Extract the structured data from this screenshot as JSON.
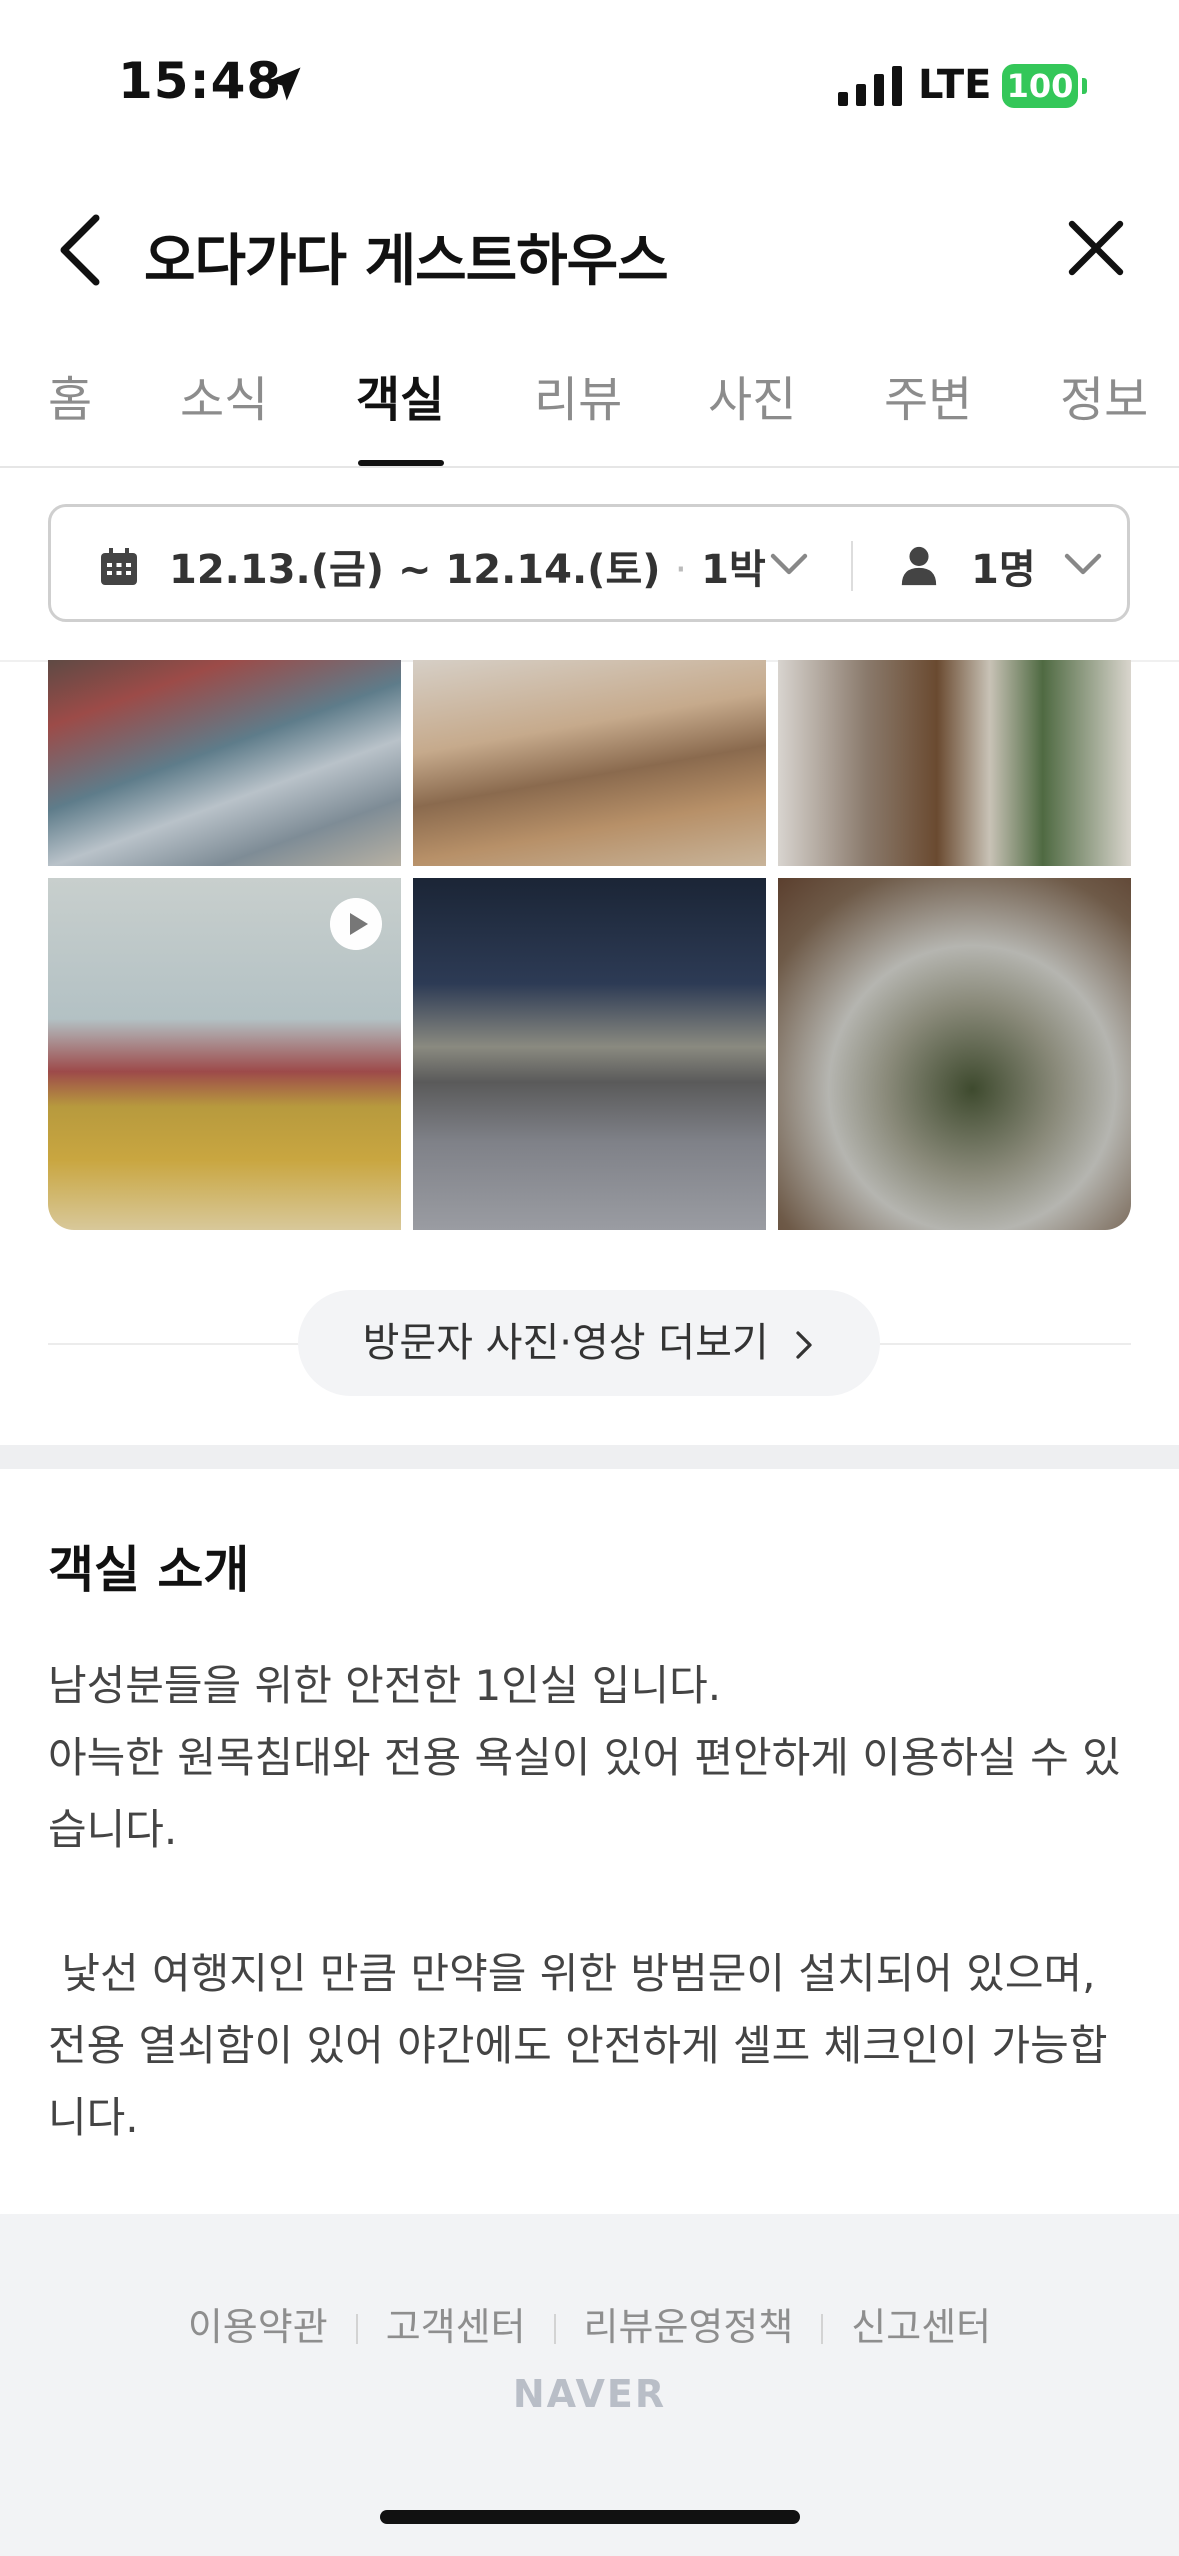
{
  "status_bar": {
    "time": "15:48",
    "network": "LTE",
    "battery": "100",
    "battery_color": "#34c759"
  },
  "header": {
    "title": "오다가다 게스트하우스",
    "back_icon": "chevron-left-icon",
    "close_icon": "close-icon"
  },
  "tabs": [
    {
      "label": "홈",
      "active": false
    },
    {
      "label": "소식",
      "active": false
    },
    {
      "label": "객실",
      "active": true
    },
    {
      "label": "리뷰",
      "active": false
    },
    {
      "label": "사진",
      "active": false
    },
    {
      "label": "주변",
      "active": false
    },
    {
      "label": "정보",
      "active": false
    }
  ],
  "booking": {
    "dates": "12.13.(금) ~ 12.14.(토)",
    "separator": "·",
    "nights": "1박",
    "guests": "1명"
  },
  "photos": {
    "more_button": "방문자 사진·영상 더보기"
  },
  "room_intro": {
    "title": "객실 소개",
    "line1": "남성분들을 위한 안전한 1인실 입니다.",
    "line2": "아늑한 원목침대와 전용 욕실이 있어 편안하게 이용하실 수 있습니다.",
    "line3": " 낯선 여행지인 만큼 만약을 위한 방범문이 설치되어 있으며, 전용 열쇠함이 있어 야간에도 안전하게 셀프 체크인이 가능합니다."
  },
  "footer": {
    "links": [
      "이용약관",
      "고객센터",
      "리뷰운영정책",
      "신고센터"
    ],
    "logo": "NAVER"
  }
}
